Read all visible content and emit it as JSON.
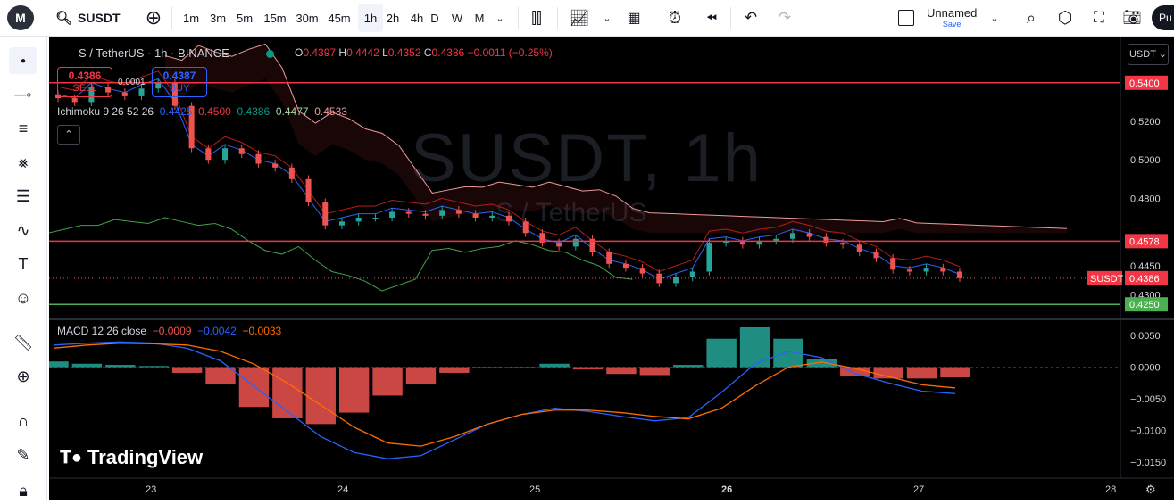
{
  "toolbar": {
    "logo_text": "M",
    "symbol": "SUSDT",
    "intervals": [
      "1m",
      "3m",
      "5m",
      "15m",
      "30m",
      "45m",
      "1h",
      "2h",
      "4h",
      "D",
      "W",
      "M"
    ],
    "active_interval": "1h",
    "layout_name": "Unnamed",
    "layout_save": "Save",
    "publish_label": "Pu"
  },
  "legend": {
    "title": "S / TetherUS · 1h · BINANCE",
    "o_label": "O",
    "o_value": "0.4397",
    "h_label": "H",
    "h_value": "0.4442",
    "l_label": "L",
    "l_value": "0.4352",
    "c_label": "C",
    "c_value": "0.4386",
    "change": "−0.0011 (−0.25%)"
  },
  "trade": {
    "sell_price": "0.4386",
    "sell_label": "SELL",
    "buy_price": "0.4387",
    "buy_label": "BUY",
    "spread": "0.0001"
  },
  "ichimoku": {
    "name": "Ichimoku 9 26 52 26",
    "v1": "0.4425",
    "v2": "0.4500",
    "v3": "0.4386",
    "v4": "0.4477",
    "v5": "0.4533"
  },
  "macd": {
    "name": "MACD 12 26 close",
    "hist": "−0.0009",
    "macd": "−0.0042",
    "signal": "−0.0033"
  },
  "watermark": {
    "line1": "SUSDT, 1h",
    "line2": "S / TetherUS"
  },
  "currency": "USDT",
  "brand": "TradingView",
  "price_axis": [
    "0.5200",
    "0.5000",
    "0.4800",
    "0.4450",
    "0.4300"
  ],
  "price_markers": {
    "top_line": "0.5400",
    "mid_line": "0.4578",
    "last_label": "SUSDT",
    "last": "0.4386",
    "low_line": "0.4250"
  },
  "macd_axis": [
    "0.0050",
    "0.0000",
    "−0.0050",
    "−0.0100",
    "−0.0150"
  ],
  "time_axis": [
    "23",
    "24",
    "25",
    "26",
    "27",
    "28"
  ],
  "colors": {
    "up": "#26a69a",
    "down": "#ef5350",
    "macd": "#2962ff",
    "signal": "#ff6d00",
    "hline": "#f23645",
    "lowline": "#4caf50"
  },
  "chart_data": {
    "type": "candlestick",
    "x": [
      "23",
      "24",
      "25",
      "26",
      "27",
      "28"
    ],
    "ylim": [
      0.42,
      0.545
    ],
    "hlines": [
      0.54,
      0.4578,
      0.425
    ],
    "close_approx": [
      0.532,
      0.53,
      0.538,
      0.535,
      0.533,
      0.537,
      0.54,
      0.528,
      0.506,
      0.5,
      0.506,
      0.503,
      0.498,
      0.496,
      0.49,
      0.478,
      0.466,
      0.468,
      0.47,
      0.47,
      0.473,
      0.472,
      0.471,
      0.474,
      0.472,
      0.47,
      0.471,
      0.468,
      0.462,
      0.457,
      0.455,
      0.459,
      0.452,
      0.446,
      0.444,
      0.441,
      0.436,
      0.439,
      0.442,
      0.457,
      0.458,
      0.456,
      0.458,
      0.459,
      0.462,
      0.46,
      0.457,
      0.456,
      0.452,
      0.449,
      0.443,
      0.442,
      0.444,
      0.442,
      0.4386
    ],
    "macd": [
      0.0035,
      0.0038,
      0.004,
      0.0038,
      0.003,
      0.001,
      -0.003,
      -0.007,
      -0.011,
      -0.0135,
      -0.0145,
      -0.014,
      -0.0115,
      -0.009,
      -0.0075,
      -0.0065,
      -0.007,
      -0.0078,
      -0.0085,
      -0.008,
      -0.004,
      0.0005,
      0.0025,
      0.0015,
      -0.001,
      -0.0025,
      -0.0038,
      -0.0042
    ],
    "signal": [
      0.003,
      0.0035,
      0.0038,
      0.0037,
      0.0035,
      0.0025,
      0.0005,
      -0.0025,
      -0.006,
      -0.0095,
      -0.012,
      -0.0125,
      -0.011,
      -0.009,
      -0.0075,
      -0.0068,
      -0.0068,
      -0.0072,
      -0.0078,
      -0.0082,
      -0.0065,
      -0.003,
      0.0,
      0.0008,
      -0.0002,
      -0.0015,
      -0.0028,
      -0.0033
    ]
  }
}
